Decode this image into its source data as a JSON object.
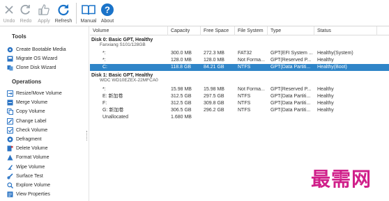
{
  "toolbar": {
    "undo": "Undo",
    "redo": "Redo",
    "apply": "Apply",
    "refresh": "Refresh",
    "manual": "Manual",
    "about": "About"
  },
  "sidebar": {
    "tools_title": "Tools",
    "tools": [
      {
        "label": "Create Bootable Media",
        "icon": "bootable-media-icon"
      },
      {
        "label": "Migrate OS Wizard",
        "icon": "migrate-os-icon"
      },
      {
        "label": "Clone Disk Wizard",
        "icon": "clone-disk-icon"
      }
    ],
    "operations_title": "Operations",
    "operations": [
      {
        "label": "Resize/Move Volume",
        "icon": "resize-icon"
      },
      {
        "label": "Merge Volume",
        "icon": "merge-icon"
      },
      {
        "label": "Copy Volume",
        "icon": "copy-icon"
      },
      {
        "label": "Change Label",
        "icon": "label-icon"
      },
      {
        "label": "Check Volume",
        "icon": "check-icon"
      },
      {
        "label": "Defragment",
        "icon": "defragment-icon"
      },
      {
        "label": "Delete Volume",
        "icon": "delete-icon"
      },
      {
        "label": "Format Volume",
        "icon": "format-icon"
      },
      {
        "label": "Wipe Volume",
        "icon": "wipe-icon"
      },
      {
        "label": "Surface Test",
        "icon": "surface-test-icon"
      },
      {
        "label": "Explore Volume",
        "icon": "explore-icon"
      },
      {
        "label": "View Properties",
        "icon": "properties-icon"
      }
    ]
  },
  "table": {
    "columns": [
      "Volume",
      "Capacity",
      "Free Space",
      "File System",
      "Type",
      "Status"
    ],
    "disks": [
      {
        "title": "Disk 0: Basic GPT, Healthy",
        "subtitle": "Fanxiang S101/128GB",
        "rows": [
          {
            "volume": "*:",
            "capacity": "300.0 MB",
            "free": "272.3 MB",
            "fs": "FAT32",
            "type": "GPT(EFI System ...",
            "status": "Healthy(System)",
            "selected": false
          },
          {
            "volume": "*:",
            "capacity": "128.0 MB",
            "free": "128.0 MB",
            "fs": "Not Forma...",
            "type": "GPT(Reserved P...",
            "status": "Healthy",
            "selected": false
          },
          {
            "volume": "C:",
            "capacity": "118.8 GB",
            "free": "84.21 GB",
            "fs": "NTFS",
            "type": "GPT(Data Partiti...",
            "status": "Healthy(Boot)",
            "selected": true
          }
        ]
      },
      {
        "title": "Disk 1: Basic GPT, Healthy",
        "subtitle": "WDC WD10EZEX-22MFCA0",
        "rows": [
          {
            "volume": "*:",
            "capacity": "15.98 MB",
            "free": "15.98 MB",
            "fs": "Not Forma...",
            "type": "GPT(Reserved P...",
            "status": "Healthy",
            "selected": false
          },
          {
            "volume": "E: 新加卷",
            "capacity": "312.5 GB",
            "free": "297.5 GB",
            "fs": "NTFS",
            "type": "GPT(Data Partiti...",
            "status": "Healthy",
            "selected": false
          },
          {
            "volume": "F:",
            "capacity": "312.5 GB",
            "free": "309.8 GB",
            "fs": "NTFS",
            "type": "GPT(Data Partiti...",
            "status": "Healthy",
            "selected": false
          },
          {
            "volume": "G: 新加卷",
            "capacity": "306.5 GB",
            "free": "296.2 GB",
            "fs": "NTFS",
            "type": "GPT(Data Partiti...",
            "status": "Healthy",
            "selected": false
          },
          {
            "volume": "Unallocated",
            "capacity": "1.680 MB",
            "free": "",
            "fs": "",
            "type": "",
            "status": "",
            "selected": false
          }
        ]
      }
    ]
  },
  "watermark": "最需网",
  "colors": {
    "selection": "#2f85c8",
    "accent": "#1a73c9",
    "watermark": "#d0208a"
  }
}
